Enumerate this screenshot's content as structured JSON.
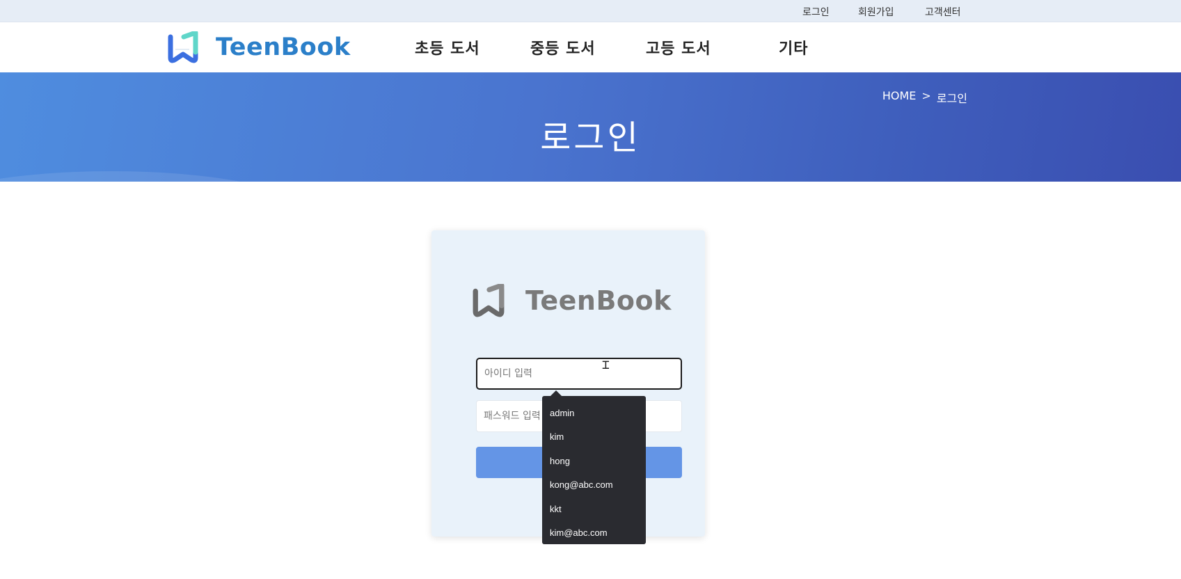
{
  "topbar": {
    "links": [
      "로그인",
      "회원가입",
      "고객센터"
    ]
  },
  "header": {
    "brand": "TeenBook",
    "nav": [
      "초등 도서",
      "중등 도서",
      "고등 도서",
      "기타"
    ]
  },
  "banner": {
    "breadcrumb_home": "HOME",
    "breadcrumb_sep": ">",
    "breadcrumb_current": "로그인",
    "title": "로그인"
  },
  "login": {
    "brand": "TeenBook",
    "id_placeholder": "아이디 입력",
    "password_placeholder": "패스워드 입력",
    "submit_label": ""
  },
  "autocomplete": {
    "options": [
      "admin",
      "kim",
      "hong",
      "kong@abc.com",
      "kkt",
      "kim@abc.com"
    ]
  },
  "colors": {
    "brand_blue": "#2b7fc9",
    "banner_start": "#4f8ddf",
    "banner_end": "#3a4eb0",
    "submit": "#6495e6",
    "dropdown_bg": "#2a2b30"
  },
  "icons": {
    "logo": "teenbook-logo-icon",
    "cursor": "text-cursor-icon"
  }
}
